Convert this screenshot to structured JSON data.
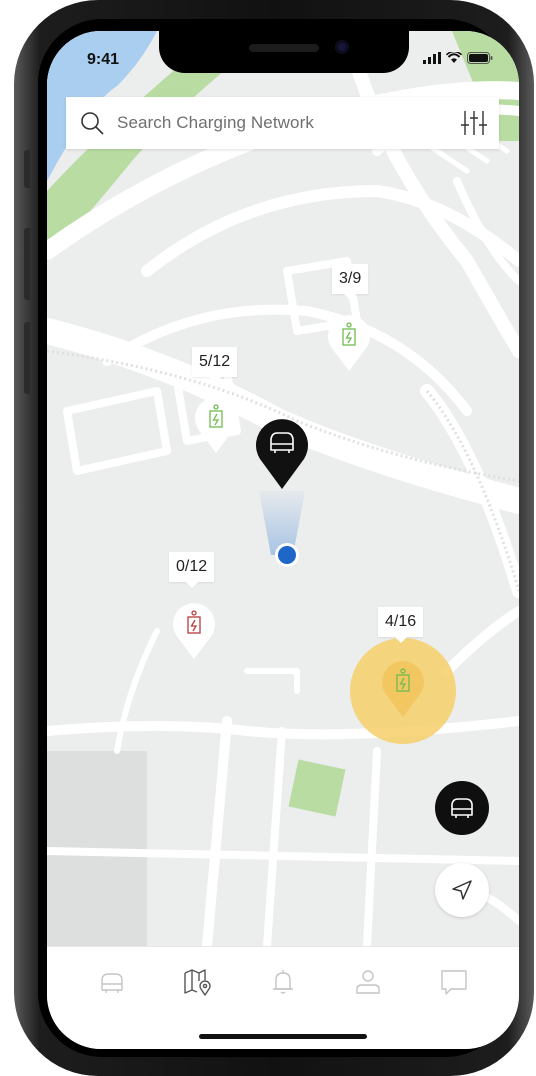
{
  "status_bar": {
    "time": "9:41"
  },
  "search": {
    "placeholder": "Search Charging Network",
    "search_icon": "search-icon",
    "filter_icon": "sliders-icon"
  },
  "stations": [
    {
      "label": "3/9",
      "status": "available",
      "color": "#6fbd4f"
    },
    {
      "label": "5/12",
      "status": "available",
      "color": "#6fbd4f"
    },
    {
      "label": "0/12",
      "status": "unavailable",
      "color": "#b73b3b"
    },
    {
      "label": "4/16",
      "status": "selected",
      "color": "#6fbd4f",
      "highlight": "#f6cf68"
    }
  ],
  "vehicle_pin": {
    "icon": "car-icon",
    "color": "#111111"
  },
  "user_location": {
    "icon": "location-dot-icon",
    "color": "#1f66c9"
  },
  "fabs": [
    {
      "icon": "car-icon"
    },
    {
      "icon": "navigation-arrow-icon"
    }
  ],
  "tabs": [
    {
      "name": "vehicle",
      "icon": "car-icon"
    },
    {
      "name": "map",
      "icon": "map-pin-icon",
      "active": true
    },
    {
      "name": "notifications",
      "icon": "bell-icon"
    },
    {
      "name": "profile",
      "icon": "user-icon"
    },
    {
      "name": "messages",
      "icon": "chat-icon"
    }
  ]
}
